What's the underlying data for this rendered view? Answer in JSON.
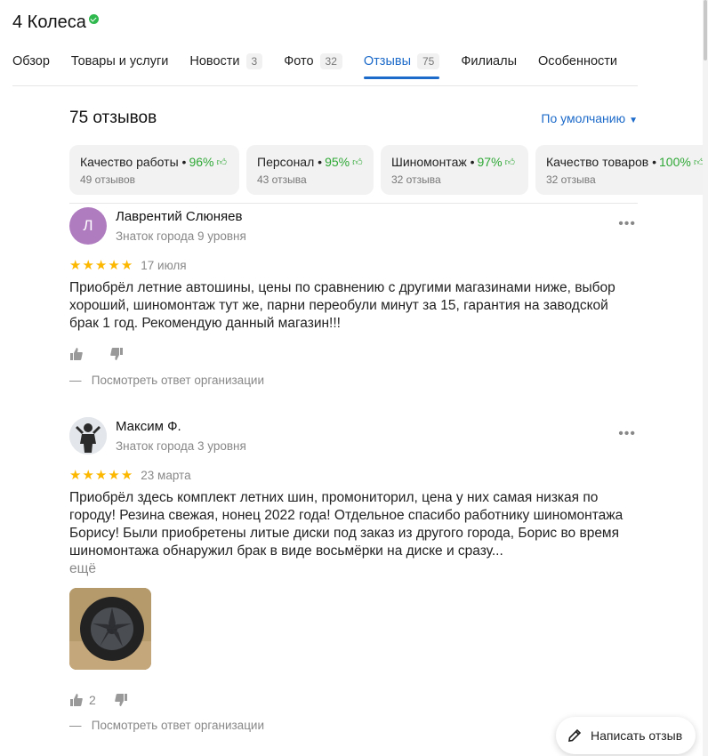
{
  "org": {
    "title": "4 Колеса"
  },
  "tabs": [
    {
      "label": "Обзор"
    },
    {
      "label": "Товары и услуги"
    },
    {
      "label": "Новости",
      "count": "3"
    },
    {
      "label": "Фото",
      "count": "32"
    },
    {
      "label": "Отзывы",
      "count": "75",
      "active": true
    },
    {
      "label": "Филиалы"
    },
    {
      "label": "Особенности"
    }
  ],
  "reviews_header": {
    "count_text": "75 отзывов",
    "sort_label": "По умолчанию"
  },
  "aspects": [
    {
      "label": "Качество работы",
      "percent": "96%",
      "sub": "49 отзывов"
    },
    {
      "label": "Персонал",
      "percent": "95%",
      "sub": "43 отзыва"
    },
    {
      "label": "Шиномонтаж",
      "percent": "97%",
      "sub": "32 отзыва"
    },
    {
      "label": "Качество товаров",
      "percent": "100%",
      "sub": "32 отзыва"
    }
  ],
  "reviews": [
    {
      "author": "Лаврентий Слюняев",
      "initial": "Л",
      "level": "Знаток города 9 уровня",
      "rating": 5,
      "date": "17 июля",
      "text": "Приобрёл летние автошины, цены по сравнению с другими магазинами ниже, выбор хороший, шиномонтаж тут же, парни переобули минут за 15, гарантия на заводской брак 1 год. Рекомендую данный магазин!!!",
      "likes": "",
      "org_reply": "Посмотреть ответ организации"
    },
    {
      "author": "Максим Ф.",
      "level": "Знаток города 3 уровня",
      "rating": 5,
      "date": "23 марта",
      "text": "Приобрёл здесь комплект летних шин, промониторил, цена у них самая низкая по городу! Резина свежая, нонец 2022 года! Отдельное спасибо работнику шиномонтажа Борису! Были приобретены литые диски под заказ из другого города, Борис во время шиномонтажа обнаружил брак в виде восьмёрки на диске и сразу...",
      "more": "ещё",
      "likes": "2",
      "org_reply": "Посмотреть ответ организации"
    }
  ],
  "write_review": {
    "label": "Написать отзыв"
  },
  "colors": {
    "accent": "#1c6ac9",
    "positive": "#2fa836",
    "star": "#fcb800",
    "avatar1": "#b07cc0"
  },
  "icons": [
    "verified-icon",
    "chevron-down-icon",
    "thumbs-up-icon",
    "thumbs-down-icon",
    "more-icon",
    "pencil-icon",
    "star-icon"
  ]
}
